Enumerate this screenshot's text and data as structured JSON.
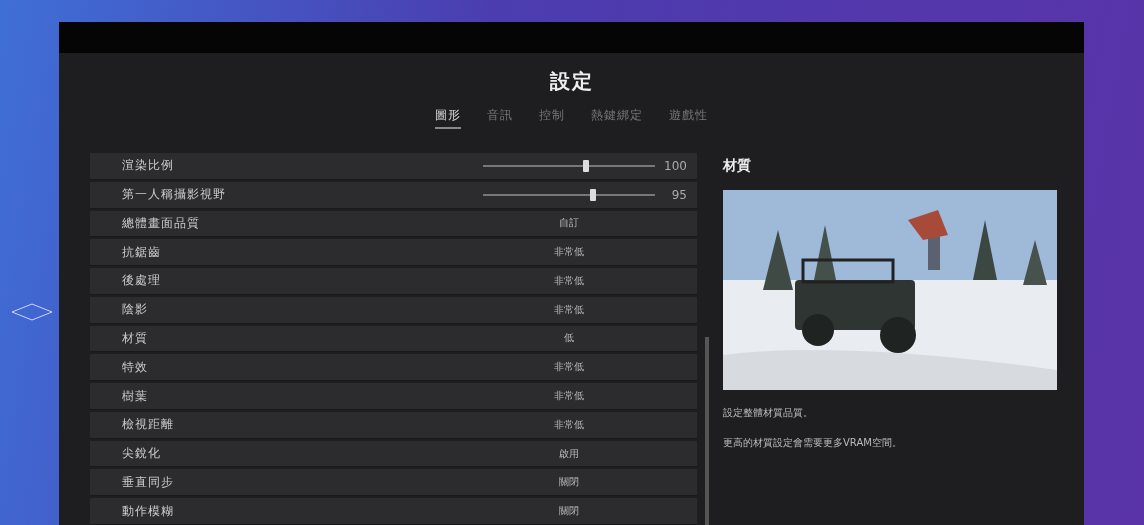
{
  "window": {
    "title": "設定"
  },
  "tabs": [
    {
      "label": "圖形",
      "selected": true
    },
    {
      "label": "音訊",
      "selected": false
    },
    {
      "label": "控制",
      "selected": false
    },
    {
      "label": "熱鍵綁定",
      "selected": false
    },
    {
      "label": "遊戲性",
      "selected": false
    }
  ],
  "settings": [
    {
      "kind": "slider",
      "label": "渲染比例",
      "level": 0.6,
      "reading": "100"
    },
    {
      "kind": "slider",
      "label": "第一人稱攝影視野",
      "level": 0.645,
      "reading": "95"
    },
    {
      "kind": "option",
      "label": "總體畫面品質",
      "value": "自訂"
    },
    {
      "kind": "option",
      "label": "抗鋸齒",
      "value": "非常低"
    },
    {
      "kind": "option",
      "label": "後處理",
      "value": "非常低"
    },
    {
      "kind": "option",
      "label": "陰影",
      "value": "非常低"
    },
    {
      "kind": "option",
      "label": "材質",
      "value": "低"
    },
    {
      "kind": "option",
      "label": "特效",
      "value": "非常低"
    },
    {
      "kind": "option",
      "label": "樹葉",
      "value": "非常低"
    },
    {
      "kind": "option",
      "label": "檢視距離",
      "value": "非常低"
    },
    {
      "kind": "option",
      "label": "尖銳化",
      "value": "啟用"
    },
    {
      "kind": "option",
      "label": "垂直同步",
      "value": "關閉"
    },
    {
      "kind": "option",
      "label": "動作模糊",
      "value": "關閉"
    }
  ],
  "detail": {
    "title": "材質",
    "description": [
      "設定整體材質品質。",
      "更高的材質設定會需要更多VRAM空間。"
    ]
  }
}
